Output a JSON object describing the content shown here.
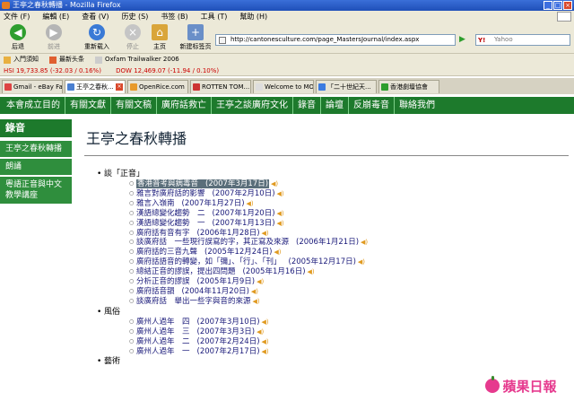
{
  "window": {
    "title": "王亭之春秋轉播 - Mozilla Firefox"
  },
  "menubar": {
    "items": [
      "文件 (F)",
      "編輯 (E)",
      "查看 (V)",
      "历史 (S)",
      "书签 (B)",
      "工具 (T)",
      "幫助 (H)"
    ]
  },
  "toolbar": {
    "back": "后退",
    "forward": "前进",
    "reload": "重新载入",
    "stop": "停止",
    "home": "主页",
    "newtab": "新建标签页"
  },
  "address": {
    "url": "http://cantonesculture.com/page_MastersJournal/index.aspx"
  },
  "search": {
    "placeholder": "Yahoo"
  },
  "bookmarks": [
    "入門須知",
    "最新头条",
    "Oxfam Trailwalker 2006"
  ],
  "ticker": {
    "hsi": "HSI 19,733.85 (-32.03 / 0.16%)",
    "dow": "DOW 12,469.07 (-11.94 / 0.10%)"
  },
  "tabs": [
    {
      "label": "Gmail - eBay Fa..."
    },
    {
      "label": "王亭之春秋..."
    },
    {
      "label": "OpenRice.com"
    },
    {
      "label": "ROTTEN TOM..."
    },
    {
      "label": "Welcome to MO..."
    },
    {
      "label": "「二十世紀天..."
    },
    {
      "label": "香港劇壇協會"
    }
  ],
  "sitenav": [
    "本會成立目的",
    "有關文獻",
    "有關文稿",
    "廣府話救亡",
    "王亭之談廣府文化",
    "錄音",
    "論壇",
    "反崩毒音",
    "聯絡我們"
  ],
  "leftnav": {
    "header": "錄音",
    "items": [
      "王亭之春秋轉播",
      "朗誦",
      "粵語正音與中文教學講座"
    ]
  },
  "main": {
    "title": "王亭之春秋轉播",
    "sections": [
      {
        "title": "談「正音」",
        "items": [
          {
            "text": "香港普考與病毒音",
            "date": "(2007年3月17日)"
          },
          {
            "text": "雅言對廣府話的影響",
            "date": "(2007年2月10日)"
          },
          {
            "text": "雅言入嶺南",
            "date": "(2007年1月27日)"
          },
          {
            "text": "漢語總變化趨勢　二",
            "date": "(2007年1月20日)"
          },
          {
            "text": "漢語總變化趨勢　一",
            "date": "(2007年1月13日)"
          },
          {
            "text": "廣府話有音有字",
            "date": "(2006年1月28日)"
          },
          {
            "text": "談廣府話　一些現行誤寫的字，其正寫及來源",
            "date": "(2006年1月21日)"
          },
          {
            "text": "廣府話的三音九聲",
            "date": "(2005年12月24日)"
          },
          {
            "text": "廣府話語音的轉變，如「彌」、「行」、「刊」",
            "date": "(2005年12月17日)"
          },
          {
            "text": "總結正音的謬誤，提出四問題",
            "date": "(2005年1月16日)"
          },
          {
            "text": "分析正音的謬誤",
            "date": "(2005年1月9日)"
          },
          {
            "text": "廣府話音韻",
            "date": "(2004年11月20日)"
          },
          {
            "text": "談廣府話　舉出一些字與音的來源",
            "date": ""
          }
        ]
      },
      {
        "title": "風俗",
        "items": [
          {
            "text": "廣州人過年　四",
            "date": "(2007年3月10日)"
          },
          {
            "text": "廣州人過年　三",
            "date": "(2007年3月3日)"
          },
          {
            "text": "廣州人過年　二",
            "date": "(2007年2月24日)"
          },
          {
            "text": "廣州人過年　一",
            "date": "(2007年2月17日)"
          }
        ]
      },
      {
        "title": "藝術",
        "items": []
      }
    ]
  },
  "watermark": {
    "text": "蘋果日報"
  },
  "colors": {
    "site_green": "#1d7a2c",
    "link_blue": "#1a1a7a",
    "watermark_pink": "#e63a8e"
  }
}
